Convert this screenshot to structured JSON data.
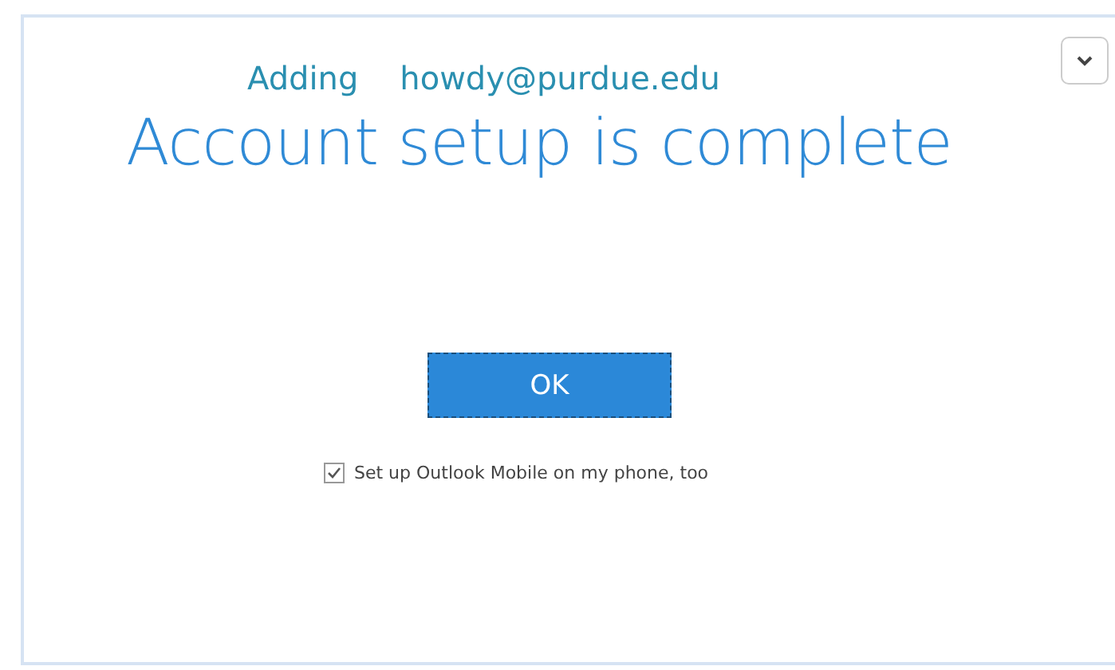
{
  "header": {
    "prefix": "Adding",
    "email": "howdy@purdue.edu"
  },
  "title": "Account setup is complete",
  "ok_button": "OK",
  "mobile_option": {
    "label": "Set up Outlook Mobile on my phone, too",
    "checked": true
  }
}
